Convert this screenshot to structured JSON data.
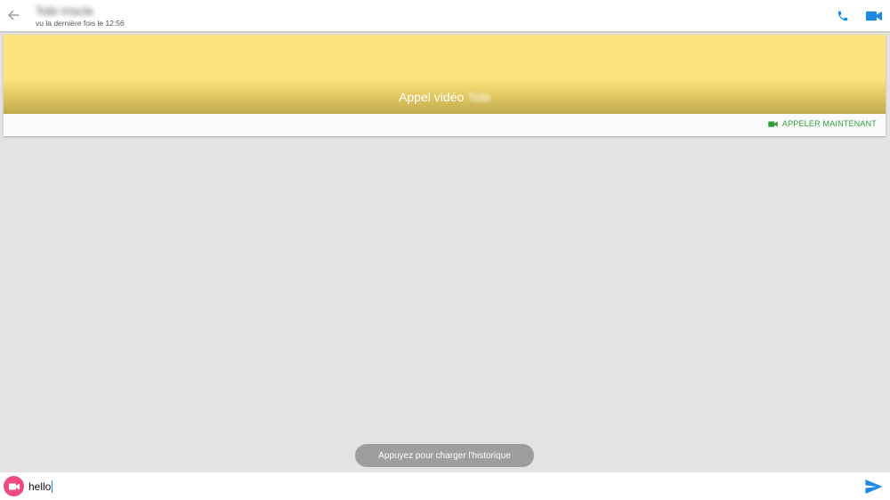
{
  "header": {
    "contact_name": "Tobi Iriscle",
    "last_seen": "vu la dernière fois le 12:56",
    "icons": [
      "back-arrow-icon",
      "phone-icon",
      "video-camera-icon"
    ],
    "accent_color": "#1e88e5"
  },
  "call_card": {
    "title": "Appel vidéo",
    "title_name": "Tobi",
    "action_label": "APPELER MAINTENANT",
    "action_color": "#2f9e3a",
    "banner_color": "#fde47c"
  },
  "history": {
    "load_label": "Appuyez pour charger l'historique"
  },
  "composer": {
    "message_value": "hello",
    "video_button_color": "#ec4c7d",
    "send_color": "#1e88e5"
  }
}
